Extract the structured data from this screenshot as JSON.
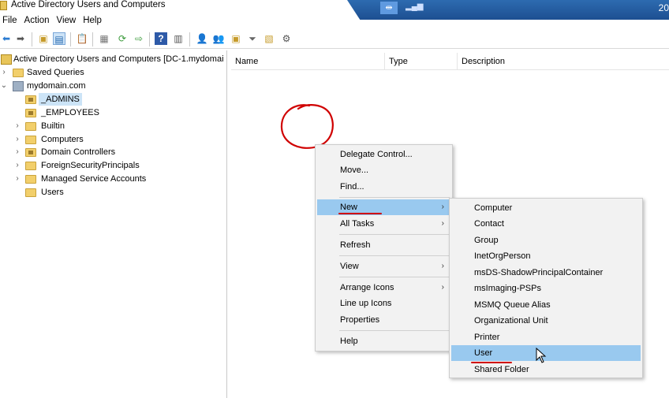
{
  "window": {
    "title": "Active Directory Users and Computers",
    "clock": "20"
  },
  "menubar": [
    "File",
    "Action",
    "View",
    "Help"
  ],
  "toolbar": {
    "icons": [
      "back-icon",
      "forward-icon",
      "up-folder-icon",
      "show-tree-icon",
      "clipboard-icon",
      "properties-icon",
      "refresh-icon",
      "export-icon",
      "help-icon",
      "console-icon",
      "new-user-icon",
      "new-group-icon",
      "new-ou-icon",
      "filter-icon",
      "find-icon",
      "delegate-icon"
    ]
  },
  "tree": {
    "root": "Active Directory Users and Computers [DC-1.mydomai",
    "saved_queries": "Saved Queries",
    "domain": "mydomain.com",
    "children": [
      "_ADMINS",
      "_EMPLOYEES",
      "Builtin",
      "Computers",
      "Domain Controllers",
      "ForeignSecurityPrincipals",
      "Managed Service Accounts",
      "Users"
    ]
  },
  "list": {
    "columns": [
      "Name",
      "Type",
      "Description"
    ]
  },
  "context_menu": {
    "items": [
      "Delegate Control...",
      "Move...",
      "Find...",
      "New",
      "All Tasks",
      "Refresh",
      "View",
      "Arrange Icons",
      "Line up Icons",
      "Properties",
      "Help"
    ]
  },
  "submenu": {
    "items": [
      "Computer",
      "Contact",
      "Group",
      "InetOrgPerson",
      "msDS-ShadowPrincipalContainer",
      "msImaging-PSPs",
      "MSMQ Queue Alias",
      "Organizational Unit",
      "Printer",
      "User",
      "Shared Folder"
    ]
  },
  "colors": {
    "highlight": "#99c9ef",
    "annotation": "#d00000",
    "taskbar": "#1d4f91"
  }
}
